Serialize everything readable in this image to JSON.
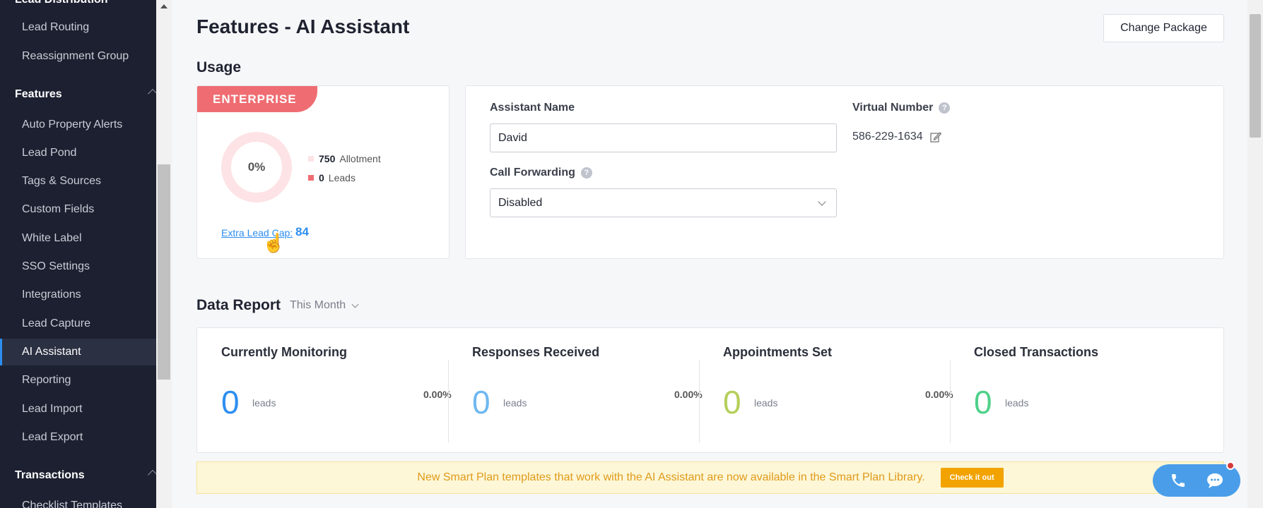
{
  "sidebar": {
    "top_partial": "Lead Distribution",
    "items_group1": [
      "Lead Routing",
      "Reassignment Group"
    ],
    "features_section": "Features",
    "features_items": [
      "Auto Property Alerts",
      "Lead Pond",
      "Tags & Sources",
      "Custom Fields",
      "White Label",
      "SSO Settings",
      "Integrations",
      "Lead Capture",
      "AI Assistant",
      "Reporting",
      "Lead Import",
      "Lead Export"
    ],
    "active_item": "AI Assistant",
    "transactions_section": "Transactions",
    "transactions_items": [
      "Checklist Templates"
    ]
  },
  "header": {
    "title": "Features - AI Assistant",
    "change_package_label": "Change Package"
  },
  "usage": {
    "section_title": "Usage",
    "package_badge": "ENTERPRISE",
    "donut_percent": "0%",
    "allotment_value": "750",
    "allotment_label": "Allotment",
    "leads_value": "0",
    "leads_label": "Leads",
    "extra_cap_label": "Extra Lead Cap:",
    "extra_cap_value": "84"
  },
  "assistant": {
    "name_label": "Assistant Name",
    "name_value": "David",
    "forwarding_label": "Call Forwarding",
    "forwarding_value": "Disabled",
    "virtual_number_label": "Virtual Number",
    "virtual_number_value": "586-229-1634"
  },
  "report": {
    "section_title": "Data Report",
    "period": "This Month",
    "stats": [
      {
        "title": "Currently Monitoring",
        "value": "0",
        "unit": "leads",
        "color": "#2d8ef0"
      },
      {
        "title": "Responses Received",
        "value": "0",
        "unit": "leads",
        "color": "#6fb8f0"
      },
      {
        "title": "Appointments Set",
        "value": "0",
        "unit": "leads",
        "color": "#b5cf5a"
      },
      {
        "title": "Closed Transactions",
        "value": "0",
        "unit": "leads",
        "color": "#4fd18a"
      }
    ],
    "percents": [
      "0.00%",
      "0.00%",
      "0.00%"
    ]
  },
  "banner": {
    "text": "New Smart Plan templates that work with the AI Assistant are now available in the Smart Plan Library.",
    "button_label": "Check it out"
  },
  "colors": {
    "accent": "#2d8ef0",
    "badge": "#ef6d72",
    "sidebar_bg": "#1c2030"
  }
}
